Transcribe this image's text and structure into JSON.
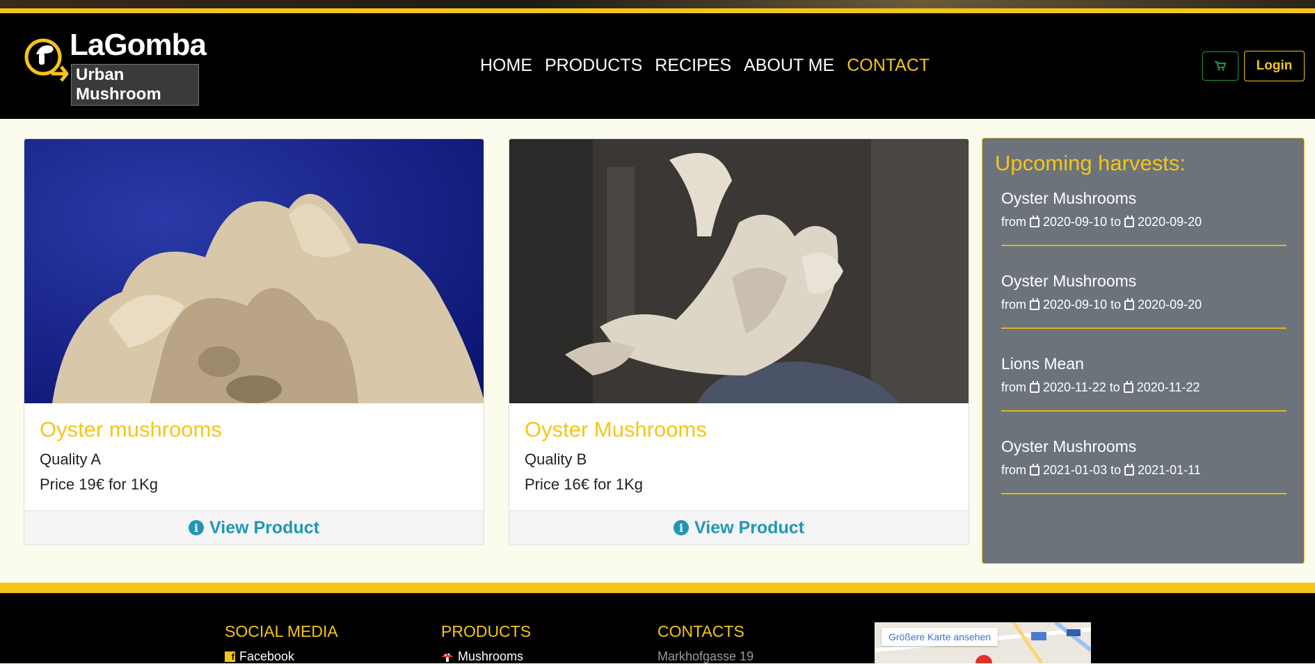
{
  "brand": {
    "name": "LaGomba",
    "tagline": "Urban Mushroom"
  },
  "nav": {
    "items": [
      {
        "label": "HOME",
        "active": false
      },
      {
        "label": "PRODUCTS",
        "active": false
      },
      {
        "label": "RECIPES",
        "active": false
      },
      {
        "label": "ABOUT ME",
        "active": false
      },
      {
        "label": "CONTACT",
        "active": true
      }
    ]
  },
  "header_buttons": {
    "cart_icon": "cart-icon",
    "login_label": "Login"
  },
  "products": [
    {
      "title": "Oyster mushrooms",
      "quality": "Quality A",
      "price": "Price 19€ for 1Kg",
      "action": "View Product"
    },
    {
      "title": "Oyster Mushrooms",
      "quality": "Quality B",
      "price": "Price 16€ for 1Kg",
      "action": "View Product"
    }
  ],
  "harvests": {
    "title": "Upcoming harvests:",
    "from_label": "from",
    "to_label": "to",
    "items": [
      {
        "name": "Oyster Mushrooms",
        "from": "2020-09-10",
        "to": "2020-09-20"
      },
      {
        "name": "Oyster Mushrooms",
        "from": "2020-09-10",
        "to": "2020-09-20"
      },
      {
        "name": "Lions Mean",
        "from": "2020-11-22",
        "to": "2020-11-22"
      },
      {
        "name": "Oyster Mushrooms",
        "from": "2021-01-03",
        "to": "2021-01-11"
      }
    ]
  },
  "footer": {
    "social": {
      "title": "SOCIAL MEDIA",
      "item": "Facebook"
    },
    "products": {
      "title": "PRODUCTS",
      "item": "Mushrooms"
    },
    "contacts": {
      "title": "CONTACTS",
      "item": "Markhofgasse 19"
    },
    "map": {
      "button": "Größere Karte ansehen"
    }
  },
  "colors": {
    "accent": "#f5c518",
    "link": "#1f96b8",
    "panel": "#6c737b",
    "cart": "#1f9a3a"
  }
}
